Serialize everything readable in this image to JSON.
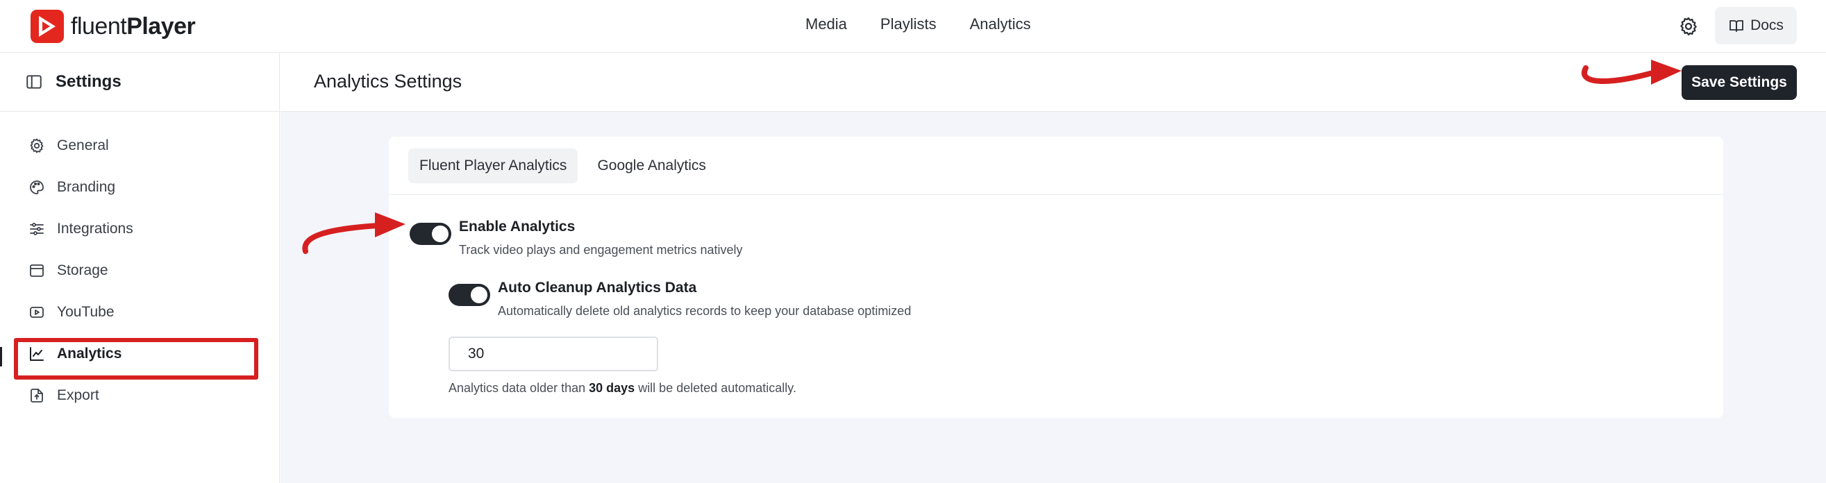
{
  "brand": {
    "name_light": "fluent",
    "name_bold": "Player"
  },
  "topnav": {
    "items": [
      "Media",
      "Playlists",
      "Analytics"
    ]
  },
  "header_actions": {
    "docs_label": "Docs",
    "settings_icon": "gear-icon"
  },
  "sidebar": {
    "title": "Settings",
    "items": [
      {
        "label": "General",
        "icon": "gear-icon"
      },
      {
        "label": "Branding",
        "icon": "palette-icon"
      },
      {
        "label": "Integrations",
        "icon": "sliders-icon"
      },
      {
        "label": "Storage",
        "icon": "storage-icon"
      },
      {
        "label": "YouTube",
        "icon": "youtube-icon"
      },
      {
        "label": "Analytics",
        "icon": "chart-icon",
        "active": true
      },
      {
        "label": "Export",
        "icon": "export-icon"
      }
    ]
  },
  "page": {
    "title": "Analytics Settings",
    "save_label": "Save Settings"
  },
  "tabs": [
    {
      "label": "Fluent Player Analytics",
      "active": true
    },
    {
      "label": "Google Analytics",
      "active": false
    }
  ],
  "options": {
    "enable": {
      "title": "Enable Analytics",
      "desc": "Track video plays and engagement metrics natively",
      "on": true
    },
    "cleanup": {
      "title": "Auto Cleanup Analytics Data",
      "desc": "Automatically delete old analytics records to keep your database optimized",
      "on": true
    }
  },
  "retention": {
    "value": "30",
    "help_prefix": "Analytics data older than ",
    "help_bold": "30 days",
    "help_suffix": " will be deleted automatically."
  },
  "colors": {
    "accent_red": "#e4271e",
    "annotation_red": "#d62020",
    "dark": "#1f232a",
    "content_bg": "#f4f5fa"
  }
}
